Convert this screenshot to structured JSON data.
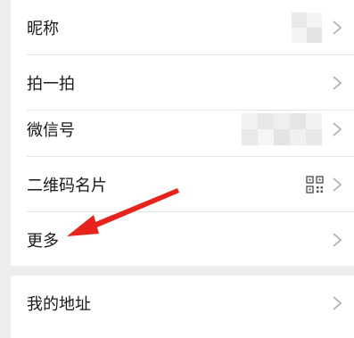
{
  "settings_list": {
    "items": [
      {
        "label": "昵称",
        "detail": "blurred-name",
        "icon": "chevron-right-icon"
      },
      {
        "label": "拍一拍",
        "icon": "chevron-right-icon"
      },
      {
        "label": "微信号",
        "detail": "blurred-id",
        "icon": "chevron-right-icon"
      },
      {
        "label": "二维码名片",
        "detail_icon": "qr-code-icon",
        "icon": "chevron-right-icon"
      },
      {
        "label": "更多",
        "icon": "chevron-right-icon"
      }
    ]
  },
  "address_section": {
    "items": [
      {
        "label": "我的地址",
        "icon": "chevron-right-icon"
      }
    ]
  },
  "annotation": {
    "icon": "red-arrow-pointer",
    "points_to": "更多",
    "color": "#e8231c"
  },
  "colors": {
    "background": "#ededed",
    "row_background": "#ffffff",
    "text": "#1a1a1a",
    "chevron": "#b2b2b2",
    "divider": "#e5e5e5"
  }
}
